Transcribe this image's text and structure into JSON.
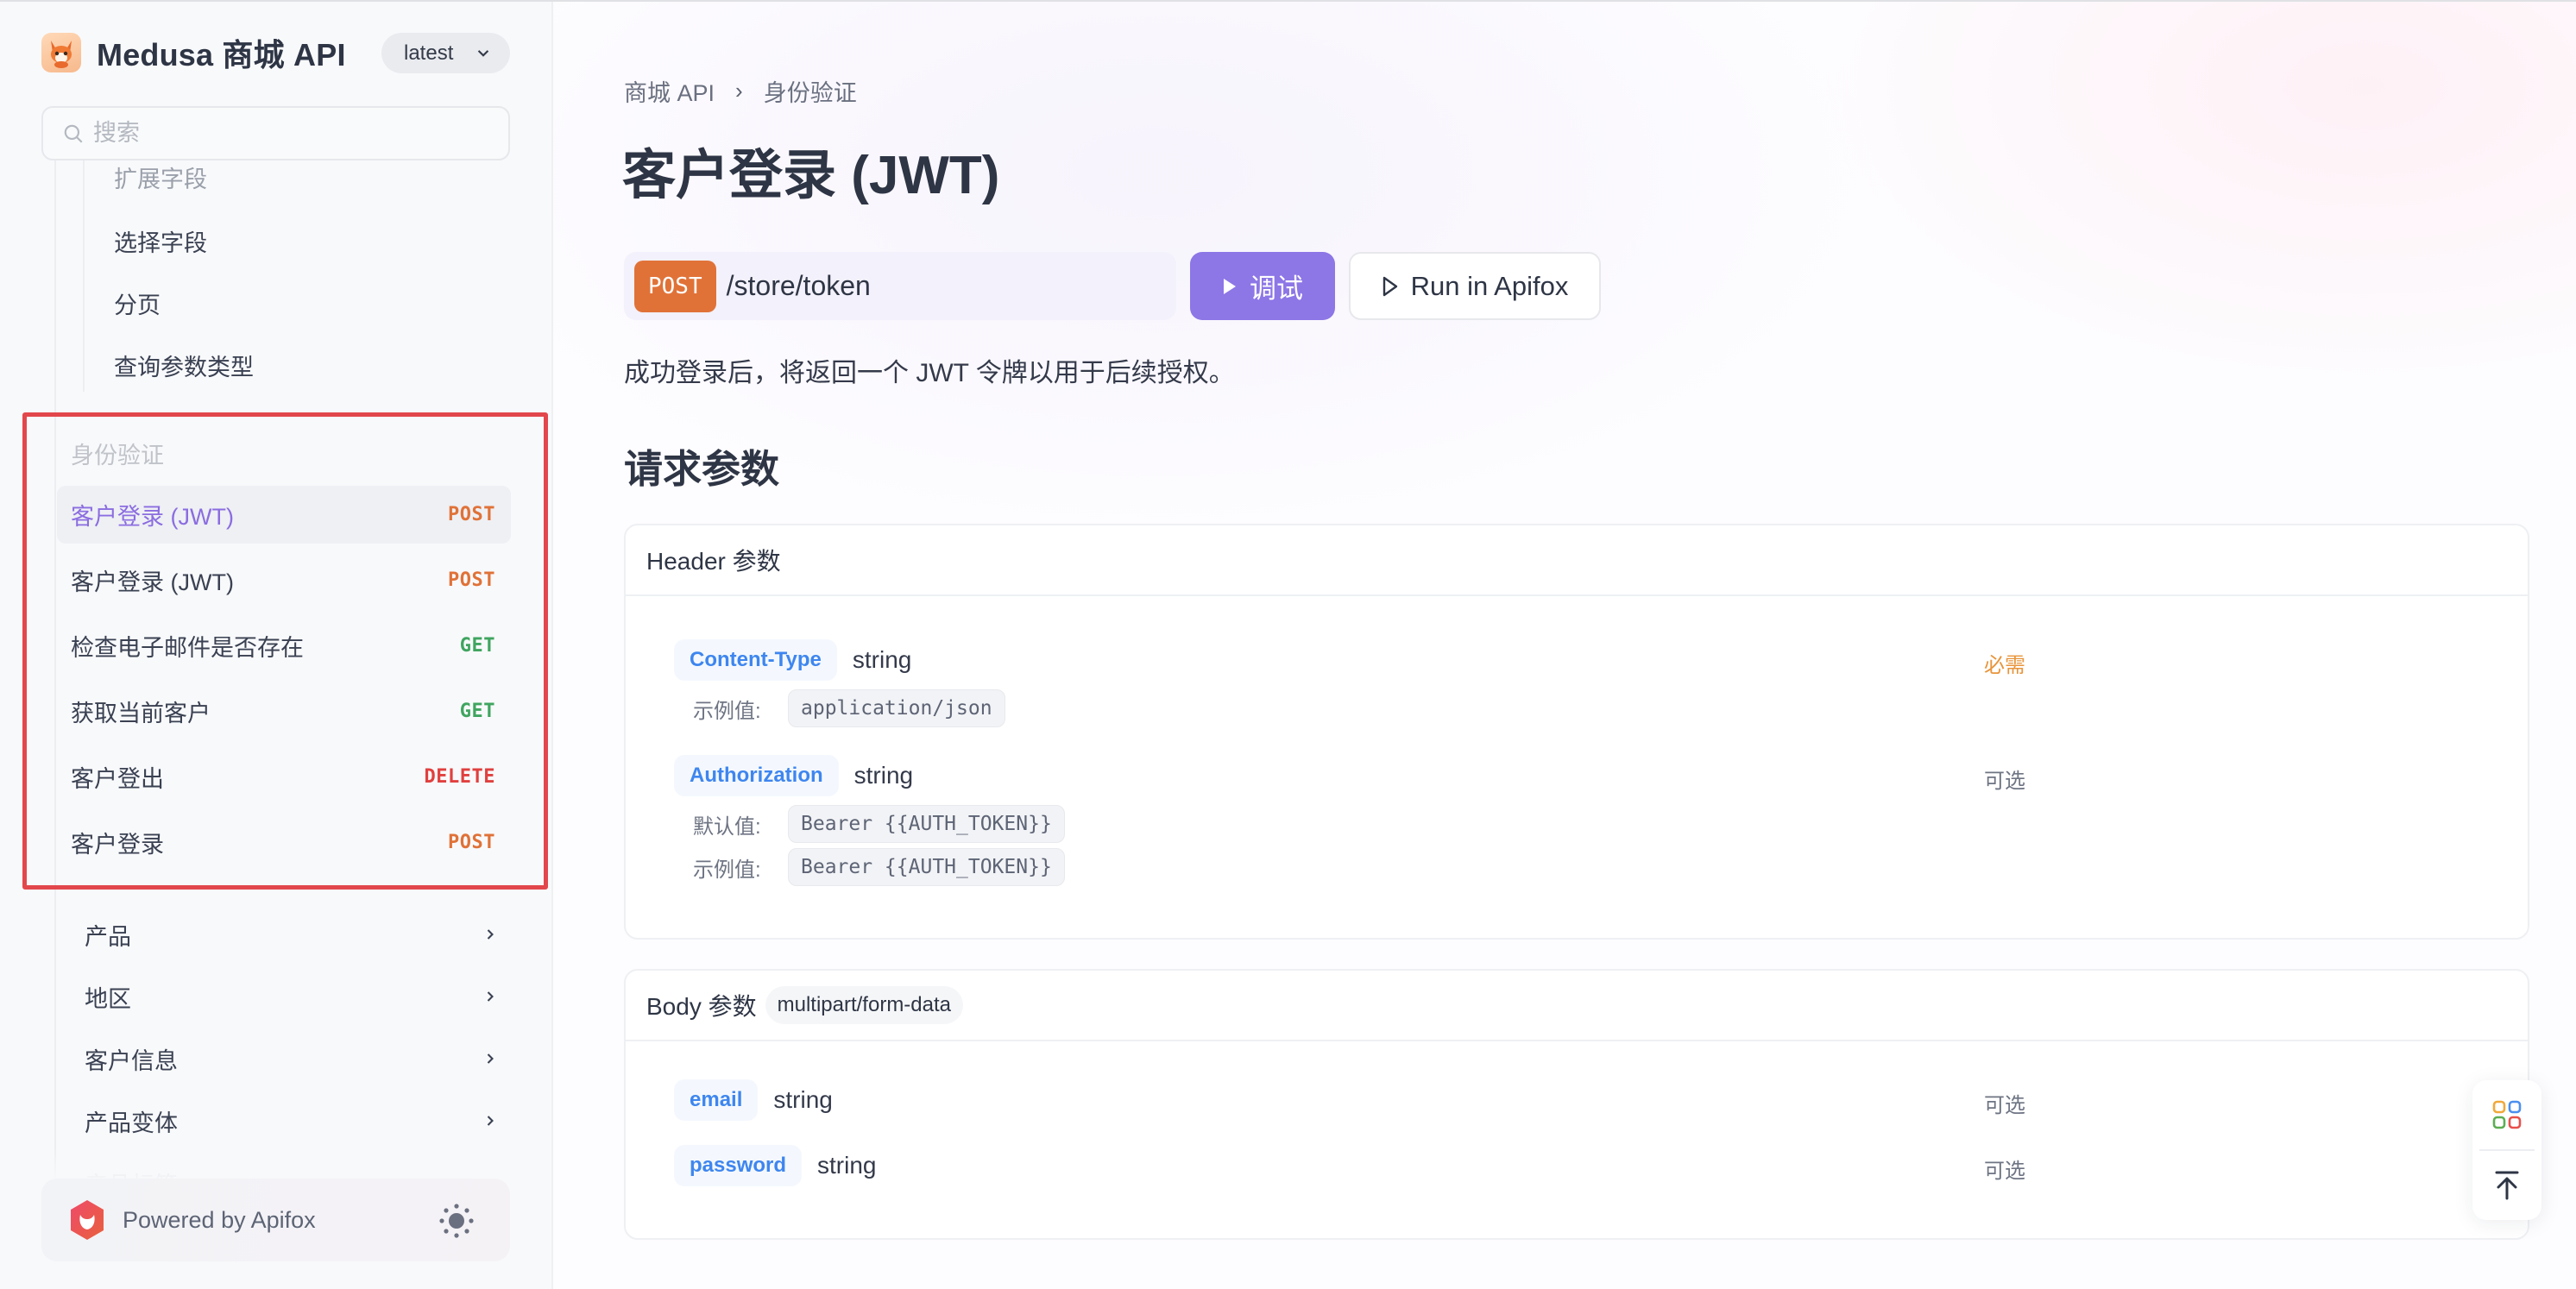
{
  "app": {
    "title": "Medusa 商城 API",
    "version": "latest"
  },
  "search": {
    "placeholder": "搜索"
  },
  "sidebar": {
    "sub_items": [
      {
        "label": "扩展字段",
        "faded": true
      },
      {
        "label": "选择字段"
      },
      {
        "label": "分页"
      },
      {
        "label": "查询参数类型"
      }
    ],
    "group": {
      "label": "身份验证",
      "items": [
        {
          "label": "客户登录 (JWT)",
          "method": "POST",
          "active": true
        },
        {
          "label": "客户登录 (JWT)",
          "method": "POST"
        },
        {
          "label": "检查电子邮件是否存在",
          "method": "GET"
        },
        {
          "label": "获取当前客户",
          "method": "GET"
        },
        {
          "label": "客户登出",
          "method": "DELETE"
        },
        {
          "label": "客户登录",
          "method": "POST"
        }
      ]
    },
    "folders": [
      {
        "label": "产品"
      },
      {
        "label": "地区"
      },
      {
        "label": "客户信息"
      },
      {
        "label": "产品变体"
      },
      {
        "label": "产品标签",
        "faded": true
      }
    ],
    "footer": {
      "powered_by": "Powered by Apifox"
    }
  },
  "colors": {
    "POST": "#e07238",
    "GET": "#3fa55f",
    "DELETE": "#e0403f",
    "accent": "#8d76e6",
    "highlight_box": "#e2474c"
  },
  "main": {
    "breadcrumb": [
      "商城 API",
      "身份验证"
    ],
    "title": "客户登录 (JWT)",
    "endpoint": {
      "method": "POST",
      "path": "/store/token"
    },
    "try_label": "调试",
    "run_label": "Run in Apifox",
    "description": "成功登录后，将返回一个 JWT 令牌以用于后续授权。",
    "section_title": "请求参数",
    "header_params": {
      "title": "Header 参数",
      "params": [
        {
          "name": "Content-Type",
          "type": "string",
          "flag": "必需",
          "example_label": "示例值:",
          "example": "application/json"
        },
        {
          "name": "Authorization",
          "type": "string",
          "flag": "可选",
          "default_label": "默认值:",
          "default": "Bearer {{AUTH_TOKEN}}",
          "example_label": "示例值:",
          "example": "Bearer {{AUTH_TOKEN}}"
        }
      ]
    },
    "body_params": {
      "title": "Body 参数",
      "mime": "multipart/form-data",
      "params": [
        {
          "name": "email",
          "type": "string",
          "flag": "可选"
        },
        {
          "name": "password",
          "type": "string",
          "flag": "可选"
        }
      ]
    }
  },
  "float_tools": {
    "apps_icon": "apps-grid-icon",
    "top_icon": "back-to-top-icon"
  }
}
